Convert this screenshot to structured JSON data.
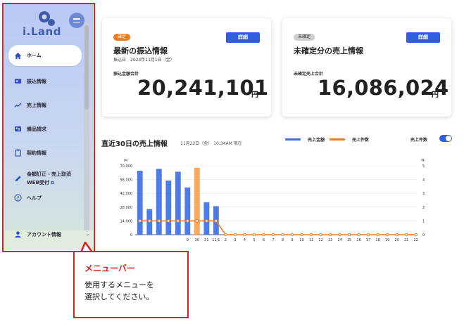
{
  "app": {
    "logo_text": "i.Land"
  },
  "sidebar": {
    "items": [
      {
        "label": "ホーム",
        "icon": "home-icon",
        "active": true
      },
      {
        "label": "振込情報",
        "icon": "transfer-icon"
      },
      {
        "label": "売上情報",
        "icon": "sales-trend-icon"
      },
      {
        "label": "備品請求",
        "icon": "supplies-request-icon"
      },
      {
        "label": "契約情報",
        "icon": "contract-clipboard-icon"
      },
      {
        "label": "金額訂正・売上取消",
        "label_line2": "WEB受付",
        "icon": "edit-pencil-icon"
      },
      {
        "label": "ヘルプ",
        "icon": "help-icon"
      }
    ],
    "account": {
      "label": "アカウント情報",
      "icon": "account-icon"
    }
  },
  "callout": {
    "title": "メニューバー",
    "body_line1": "使用するメニューを",
    "body_line2": "選択してください。"
  },
  "cards": {
    "confirmed": {
      "badge": "確定",
      "badge_color": "#f07a1e",
      "title": "最新の振込情報",
      "subtitle": "振込日　2024年11月1日（金）",
      "button": "詳細",
      "label": "振込金額合計",
      "amount": "20,241,101",
      "unit": "円"
    },
    "unconfirmed": {
      "badge": "未確定",
      "badge_color": "#c8c8c8",
      "title": "未確定分の売上情報",
      "button": "詳細",
      "label": "未確定売上合計",
      "amount": "16,086,024",
      "unit": "円"
    }
  },
  "chart_section": {
    "title": "直近30日の売上情報",
    "date": "11月22日（金） 10:34AM 現在",
    "legend_amount": "売上金額",
    "legend_count": "売上件数",
    "toggle_label": "売上件数",
    "toggle_on": true
  },
  "chart_data": {
    "type": "bar",
    "left_unit": "円",
    "right_unit": "件",
    "left_ticks": [
      "70,000",
      "56,000",
      "42,000",
      "28,000",
      "14,000",
      "0"
    ],
    "right_ticks": [
      "5",
      "4",
      "3",
      "2",
      "1",
      "0"
    ],
    "ylim": [
      0,
      70000
    ],
    "y2lim": [
      0,
      5
    ],
    "categories": [
      "",
      "",
      "",
      "",
      "",
      "9",
      "30",
      "31",
      "11/1",
      "2",
      "3",
      "4",
      "5",
      "6",
      "7",
      "8",
      "9",
      "10",
      "11",
      "12",
      "13",
      "14",
      "15",
      "16",
      "17",
      "18",
      "19",
      "20",
      "21",
      "22"
    ],
    "series": [
      {
        "name": "売上金額",
        "kind": "bar",
        "color": "#3a6ee8",
        "highlight_color": "#f5a050",
        "highlight_index": 6,
        "values": [
          65000,
          26000,
          67000,
          55000,
          64000,
          48000,
          68000,
          33000,
          29000,
          0,
          0,
          0,
          0,
          0,
          0,
          0,
          0,
          0,
          0,
          0,
          0,
          0,
          0,
          0,
          0,
          0,
          0,
          0,
          0,
          0
        ]
      },
      {
        "name": "売上件数",
        "kind": "line",
        "color": "#f07a1e",
        "values": [
          1,
          1,
          1,
          1,
          1,
          1,
          1,
          1,
          1,
          0,
          0,
          0,
          0,
          0,
          0,
          0,
          0,
          0,
          0,
          0,
          0,
          0,
          0,
          0,
          0,
          0,
          0,
          0,
          0,
          0
        ]
      }
    ]
  }
}
